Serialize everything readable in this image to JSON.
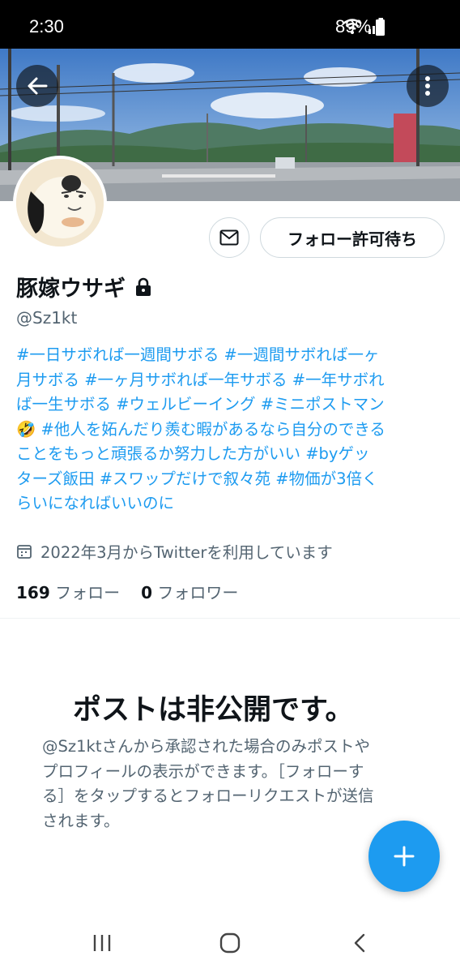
{
  "status_bar": {
    "time": "2:30",
    "battery": "89%",
    "icons": [
      "wifi-icon",
      "signal-icon",
      "battery-icon"
    ]
  },
  "header": {
    "back_icon": "arrow-left-icon",
    "more_icon": "more-vertical-icon"
  },
  "profile": {
    "display_name": "豚嫁ウサギ",
    "protected_icon": "lock-icon",
    "handle": "@Sz1kt",
    "dm_icon": "envelope-icon",
    "follow_button": "フォロー許可待ち",
    "bio_lines": [
      "#一日サボれば一週間サボる #一週間サボれば一ヶ",
      "月サボる #一ヶ月サボれば一年サボる #一年サボれ",
      "ば一生サボる #ウェルビーイング #ミニポストマン",
      "🤣 #他人を妬んだり羨む暇があるなら自分のできる",
      "ことをもっと頑張るか努力した方がいい #byゲッ",
      "ターズ飯田 #スワップだけで叙々苑 #物価が3倍く",
      "らいになればいいのに"
    ],
    "joined_icon": "calendar-icon",
    "joined": "2022年3月からTwitterを利用しています",
    "following_count": "169",
    "following_label": "フォロー",
    "followers_count": "0",
    "followers_label": "フォロワー"
  },
  "private_notice": {
    "title": "ポストは非公開です。",
    "desc_lines": [
      "@Sz1ktさんから承認された場合のみポストや",
      "プロフィールの表示ができます。［フォローす",
      "る］をタップするとフォローリクエストが送信",
      "されます。"
    ]
  },
  "fab": {
    "icon": "plus-icon"
  },
  "nav_bar": {
    "icons": [
      "recent-apps-icon",
      "home-icon",
      "back-icon"
    ]
  },
  "colors": {
    "accent": "#1d9bf0",
    "text": "#0f1419",
    "secondary": "#536471"
  }
}
